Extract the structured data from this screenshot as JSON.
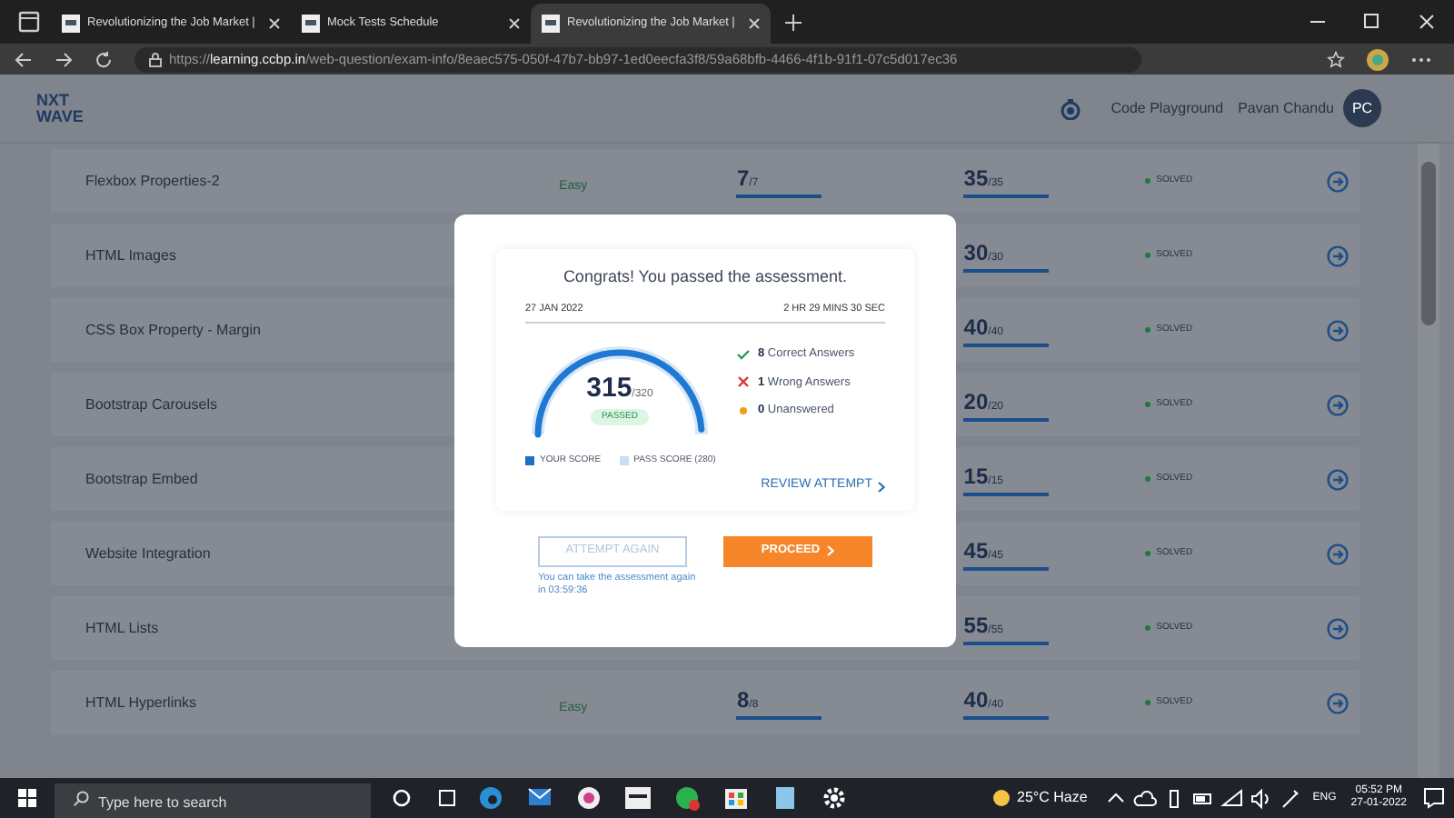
{
  "browser": {
    "tabs": [
      {
        "title": "Revolutionizing the Job Market |",
        "selected": false
      },
      {
        "title": "Mock Tests Schedule",
        "selected": false
      },
      {
        "title": "Revolutionizing the Job Market |",
        "selected": true
      }
    ],
    "url_scheme": "https://",
    "url_host": "learning.ccbp.in",
    "url_path": "/web-question/exam-info/8eaec575-050f-47b7-bb97-1ed0eecfa3f8/59a68bfb-4466-4f1b-91f1-07c5d017ec36"
  },
  "header": {
    "logo_top": "NXT",
    "logo_bottom": "WAVE",
    "link": "Code Playground",
    "user": "Pavan Chandu",
    "avatar": "PC"
  },
  "rows": [
    {
      "name": "Flexbox Properties-2",
      "difficulty": "Easy",
      "questions": {
        "value": "7",
        "total": "/7"
      },
      "score": {
        "value": "35",
        "total": "/35"
      },
      "status": "SOLVED"
    },
    {
      "name": "HTML Images",
      "score": {
        "value": "30",
        "total": "/30"
      },
      "status": "SOLVED"
    },
    {
      "name": "CSS Box Property - Margin",
      "score": {
        "value": "40",
        "total": "/40"
      },
      "status": "SOLVED"
    },
    {
      "name": "Bootstrap Carousels",
      "score": {
        "value": "20",
        "total": "/20"
      },
      "status": "SOLVED"
    },
    {
      "name": "Bootstrap Embed",
      "score": {
        "value": "15",
        "total": "/15"
      },
      "status": "SOLVED"
    },
    {
      "name": "Website Integration",
      "score": {
        "value": "45",
        "total": "/45"
      },
      "status": "SOLVED"
    },
    {
      "name": "HTML Lists",
      "score": {
        "value": "55",
        "total": "/55"
      },
      "status": "SOLVED"
    },
    {
      "name": "HTML Hyperlinks",
      "difficulty": "Easy",
      "questions": {
        "value": "8",
        "total": "/8"
      },
      "score": {
        "value": "40",
        "total": "/40"
      },
      "status": "SOLVED"
    }
  ],
  "modal": {
    "title": "Congrats! You passed the assessment.",
    "date": "27 JAN 2022",
    "duration": "2 HR 29 MINS 30 SEC",
    "gauge": {
      "level": 0.98
    },
    "score": "315",
    "total": "/320",
    "badge": "PASSED",
    "stats": [
      {
        "kind": "correct",
        "count": "8",
        "label": "Correct Answers"
      },
      {
        "kind": "wrong",
        "count": "1",
        "label": "Wrong Answers"
      },
      {
        "kind": "unanswered",
        "count": "0",
        "label": "Unanswered"
      }
    ],
    "legend": [
      {
        "label": "YOUR SCORE",
        "color": "#1f6fc4"
      },
      {
        "label": "PASS SCORE (280)",
        "color": "#c7def3"
      }
    ],
    "review": "REVIEW ATTEMPT",
    "attempt_again": {
      "label": "ATTEMPT AGAIN",
      "disabled": true
    },
    "proceed": "PROCEED",
    "note": "You can take the assessment again in 03:59:36"
  },
  "taskbar": {
    "search_placeholder": "Type here to search",
    "weather": "25°C Haze",
    "language": "ENG",
    "time": "05:52 PM",
    "date": "27-01-2022"
  }
}
